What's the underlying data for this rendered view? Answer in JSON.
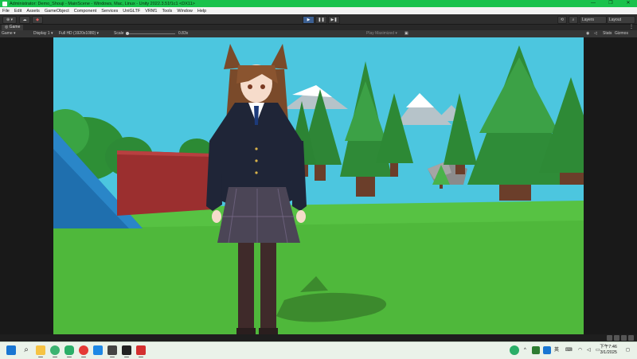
{
  "window": {
    "title": "Administrator: Demo_Shouji - MainScene - Windows, Mac, Linux - Unity 2022.3.51f1c1 <DX11>",
    "minimize": "—",
    "maximize": "❐",
    "close": "✕"
  },
  "menu": {
    "items": [
      "File",
      "Edit",
      "Assets",
      "GameObject",
      "Component",
      "Services",
      "UniGLTF",
      "VRM1",
      "Tools",
      "Window",
      "Help"
    ]
  },
  "toolbar": {
    "account_label": "⊕ ▾",
    "cloud_icon": "cloud-icon",
    "layers_label": "Layers",
    "layout_label": "Layout",
    "play": "▶",
    "pause": "❚❚",
    "step": "▶❚"
  },
  "game_tab": {
    "label": "Game"
  },
  "game_toolbar": {
    "view": "Game",
    "display": "Display 1",
    "resolution": "Full HD (1920x1080)",
    "scale_label": "Scale",
    "scale_value": "0.83x",
    "play_mode": "Play Maximized",
    "stats": "Stats",
    "gizmos": "Gizmos"
  },
  "taskbar": {
    "clock_time": "下午7:46",
    "clock_date": "3/1/2025",
    "ime_label": "英",
    "chevron": "^",
    "colors": {
      "windows": "#1976d2",
      "chrome": "#e53935",
      "folder": "#f6c343",
      "wechat": "#2aae67"
    }
  },
  "scene": {
    "sky": "#4cc6df",
    "grass": "#4fb83b",
    "character": "anime-schoolgirl-avatar"
  }
}
